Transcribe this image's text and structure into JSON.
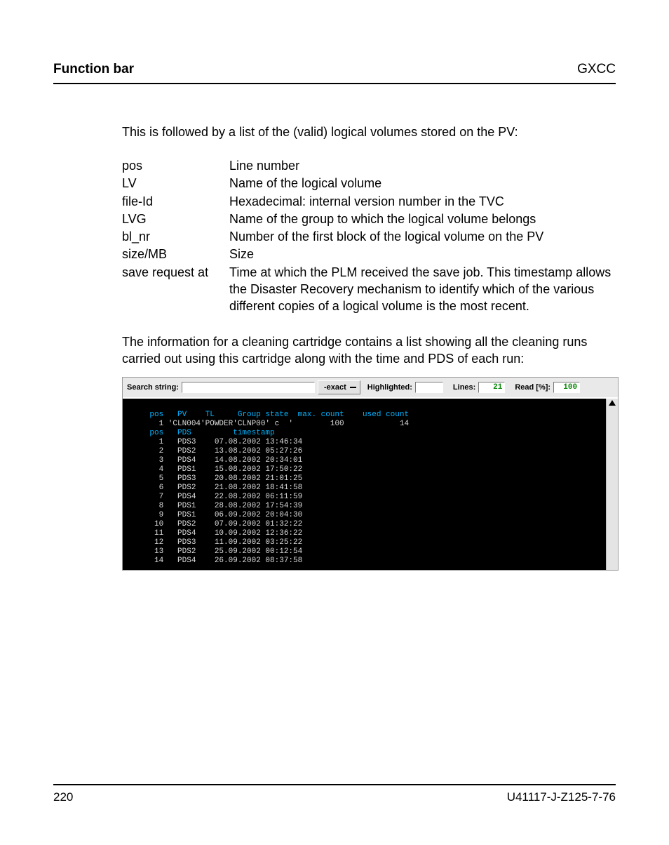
{
  "header": {
    "left": "Function bar",
    "right": "GXCC"
  },
  "intro": "This is followed by a list of the (valid) logical volumes stored on the PV:",
  "defs": [
    {
      "term": "pos",
      "desc": "Line number"
    },
    {
      "term": "LV",
      "desc": "Name of the logical volume"
    },
    {
      "term": "file-Id",
      "desc": "Hexadecimal: internal version number in the TVC"
    },
    {
      "term": "LVG",
      "desc": "Name of the group to which the logical volume belongs"
    },
    {
      "term": "bl_nr",
      "desc": "Number of the first block of the logical volume on the PV"
    },
    {
      "term": "size/MB",
      "desc": "Size"
    },
    {
      "term": "save request at",
      "desc": "Time at which the PLM received the save job. This timestamp allows the Disaster Recovery mechanism to identify which of the various different copies of a logical volume is the most recent."
    }
  ],
  "para2": "The information for a cleaning cartridge contains a list showing all the cleaning runs carried out using this cartridge along with the time and PDS of each run:",
  "toolbar": {
    "search_label": "Search string:",
    "search_value": "",
    "exact_label": "-exact",
    "hl_label": "Highlighted:",
    "hl_value": "",
    "lines_label": "Lines:",
    "lines_value": "21",
    "read_label": "Read [%]:",
    "read_value": "100"
  },
  "terminal": {
    "header1": "    pos   PV    TL     Group state  max. count    used count",
    "header1_row": "      1 'CLN004'POWDER'CLNP00' c  '        100            14",
    "header2": "    pos   PDS         timestamp",
    "rows": [
      {
        "pos": "1",
        "pds": "PDS3",
        "ts": "07.08.2002 13:46:34"
      },
      {
        "pos": "2",
        "pds": "PDS2",
        "ts": "13.08.2002 05:27:26"
      },
      {
        "pos": "3",
        "pds": "PDS4",
        "ts": "14.08.2002 20:34:01"
      },
      {
        "pos": "4",
        "pds": "PDS1",
        "ts": "15.08.2002 17:50:22"
      },
      {
        "pos": "5",
        "pds": "PDS3",
        "ts": "20.08.2002 21:01:25"
      },
      {
        "pos": "6",
        "pds": "PDS2",
        "ts": "21.08.2002 18:41:58"
      },
      {
        "pos": "7",
        "pds": "PDS4",
        "ts": "22.08.2002 06:11:59"
      },
      {
        "pos": "8",
        "pds": "PDS1",
        "ts": "28.08.2002 17:54:39"
      },
      {
        "pos": "9",
        "pds": "PDS1",
        "ts": "06.09.2002 20:04:30"
      },
      {
        "pos": "10",
        "pds": "PDS2",
        "ts": "07.09.2002 01:32:22"
      },
      {
        "pos": "11",
        "pds": "PDS4",
        "ts": "10.09.2002 12:36:22"
      },
      {
        "pos": "12",
        "pds": "PDS3",
        "ts": "11.09.2002 03:25:22"
      },
      {
        "pos": "13",
        "pds": "PDS2",
        "ts": "25.09.2002 00:12:54"
      },
      {
        "pos": "14",
        "pds": "PDS4",
        "ts": "26.09.2002 08:37:58"
      }
    ]
  },
  "footer": {
    "page": "220",
    "docid": "U41117-J-Z125-7-76"
  }
}
